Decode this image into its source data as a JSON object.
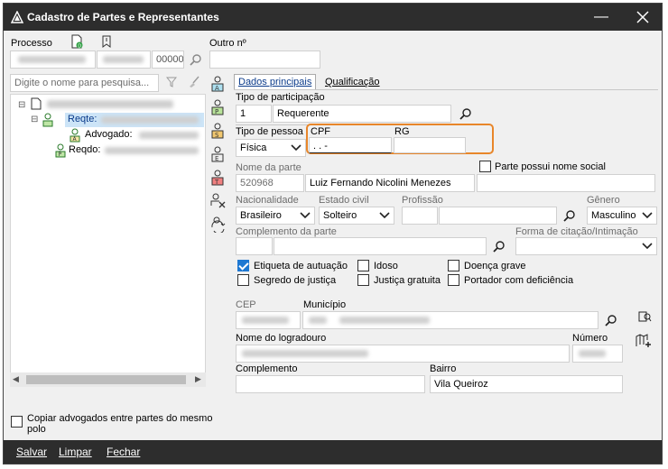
{
  "window": {
    "title": "Cadastro de Partes e Representantes"
  },
  "processo": {
    "label": "Processo",
    "number_suffix": "00000"
  },
  "outro": {
    "label": "Outro nº"
  },
  "search": {
    "placeholder": "Digite o nome para pesquisa..."
  },
  "tree": {
    "reqte_label": "Reqte:",
    "advogado_label": "Advogado:",
    "reqdo_label": "Reqdo:"
  },
  "tabs": {
    "dados": "Dados principais",
    "qualificacao": "Qualificação"
  },
  "tipo_participacao": {
    "label": "Tipo de participação",
    "code": "1",
    "value": "Requerente"
  },
  "tipo_pessoa": {
    "label": "Tipo de pessoa",
    "value": "Física"
  },
  "cpf": {
    "label": "CPF",
    "value": " .  .  -"
  },
  "rg": {
    "label": "RG",
    "value": ""
  },
  "nome_parte": {
    "label": "Nome da parte",
    "code": "520968",
    "value": "Luiz Fernando Nicolini Menezes"
  },
  "nome_social": {
    "label": "Parte possui nome social"
  },
  "nacionalidade": {
    "label": "Nacionalidade",
    "value": "Brasileiro"
  },
  "estado_civil": {
    "label": "Estado civil",
    "value": "Solteiro"
  },
  "profissao": {
    "label": "Profissão"
  },
  "genero": {
    "label": "Gênero",
    "value": "Masculino"
  },
  "complemento_parte": {
    "label": "Complemento da parte"
  },
  "forma_citacao": {
    "label": "Forma de citação/Intimação"
  },
  "checks": {
    "etiqueta": "Etiqueta de autuação",
    "idoso": "Idoso",
    "doenca": "Doença grave",
    "segredo": "Segredo de justiça",
    "gratuita": "Justiça gratuita",
    "deficiencia": "Portador com deficiência"
  },
  "cep": {
    "label": "CEP"
  },
  "municipio": {
    "label": "Município"
  },
  "logradouro": {
    "label": "Nome do logradouro"
  },
  "numero": {
    "label": "Número"
  },
  "complemento": {
    "label": "Complemento"
  },
  "bairro": {
    "label": "Bairro",
    "value": "Vila Queiroz"
  },
  "copiar": {
    "label_line1": "Copiar advogados entre partes do mesmo",
    "label_line2": "polo"
  },
  "actions": {
    "salvar": "Salvar",
    "limpar": "Limpar",
    "fechar": "Fechar"
  },
  "colors": {
    "accent_orange": "#e8862a",
    "checkbox_blue": "#1e78d2",
    "titlebar": "#2d2d2d"
  }
}
